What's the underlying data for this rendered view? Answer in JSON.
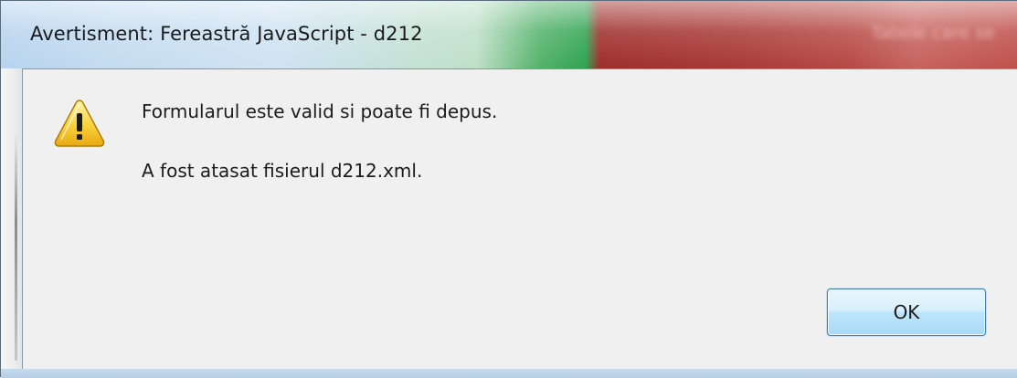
{
  "window": {
    "title": "Avertisment: Fereastră JavaScript - d212",
    "background_window_title": "Tabele care se"
  },
  "dialog": {
    "icon": "warning-icon",
    "message_line1": "Formularul este valid si poate fi depus.",
    "message_line2": "A fost atasat fisierul d212.xml.",
    "ok_label": "OK"
  },
  "colors": {
    "client_background": "#f0f0f0",
    "button_border": "#3c7fb1",
    "warning_yellow": "#f7c82d"
  }
}
